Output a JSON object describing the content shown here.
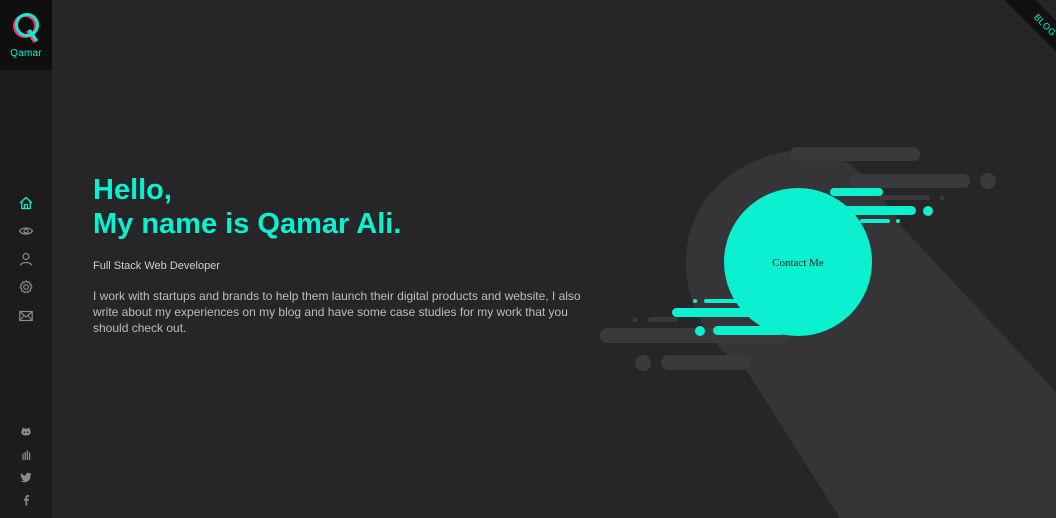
{
  "brand": {
    "logo_letter": "Q",
    "name": "Qamar",
    "accent_color": "#0bf1d0",
    "accent_shadow": "#ff2d6f"
  },
  "sidebar": {
    "nav": [
      {
        "icon": "home-icon",
        "active": true
      },
      {
        "icon": "eye-icon",
        "active": false
      },
      {
        "icon": "user-icon",
        "active": false
      },
      {
        "icon": "gear-icon",
        "active": false
      },
      {
        "icon": "mail-icon",
        "active": false
      }
    ],
    "social": [
      {
        "icon": "github-icon"
      },
      {
        "icon": "codepen-icon"
      },
      {
        "icon": "twitter-icon"
      },
      {
        "icon": "facebook-icon"
      }
    ]
  },
  "ribbon": {
    "label": "BLOG"
  },
  "hero": {
    "greeting_line1": "Hello,",
    "greeting_line2": "My name is Qamar Ali.",
    "role": "Full Stack Web Developer",
    "about": "I work with startups and brands to help them launch their digital products and website, I also write about my experiences on my blog and have some case studies for my work that you should check out.",
    "contact_label": "Contact Me"
  },
  "colors": {
    "background": "#262628",
    "sidebar": "#1c1c1d",
    "shape_gray": "#3a3a3c"
  }
}
